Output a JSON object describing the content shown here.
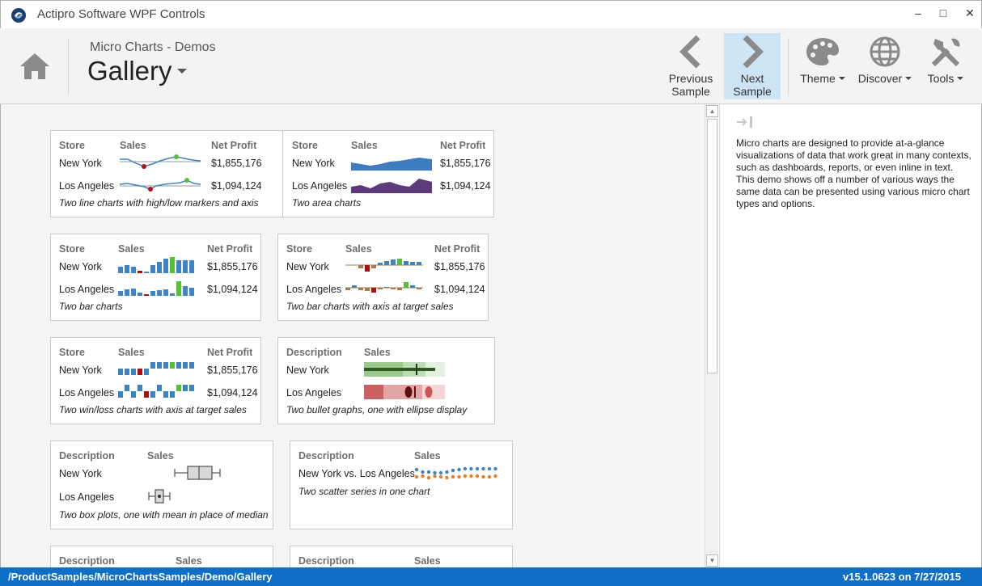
{
  "window": {
    "title": "Actipro Software WPF Controls",
    "minimize_glyph": "‒",
    "maximize_glyph": "□",
    "close_glyph": "✕"
  },
  "header": {
    "subtitle": "Micro Charts - Demos",
    "title": "Gallery",
    "buttons": {
      "previous": [
        "Previous",
        "Sample"
      ],
      "next": [
        "Next",
        "Sample"
      ],
      "theme": "Theme",
      "discover": "Discover",
      "tools": "Tools"
    }
  },
  "colors": {
    "accent": "#0f6fc6",
    "blue": "#3e84c5",
    "green": "#52c234",
    "red": "#b00d13",
    "tan": "#a57c4f",
    "orange": "#e67e22",
    "area_blue": "#3f7cbf",
    "area_purple": "#5d3b7a"
  },
  "cards": {
    "c1": {
      "h1": "Store",
      "h2": "Sales",
      "h3": "Net Profit",
      "r1": "New York",
      "r2": "Los Angeles",
      "v1": "$1,855,176",
      "v2": "$1,094,124",
      "caption": "Two line charts with high/low markers and axis"
    },
    "c2": {
      "h1": "Store",
      "h2": "Sales",
      "h3": "Net Profit",
      "r1": "New York",
      "r2": "Los Angeles",
      "v1": "$1,855,176",
      "v2": "$1,094,124",
      "caption": "Two area charts"
    },
    "c3": {
      "h1": "Store",
      "h2": "Sales",
      "h3": "Net Profit",
      "r1": "New York",
      "r2": "Los Angeles",
      "v1": "$1,855,176",
      "v2": "$1,094,124",
      "caption": "Two bar charts"
    },
    "c4": {
      "h1": "Store",
      "h2": "Sales",
      "h3": "Net Profit",
      "r1": "New York",
      "r2": "Los Angeles",
      "v1": "$1,855,176",
      "v2": "$1,094,124",
      "caption": "Two bar charts with axis at target sales"
    },
    "c5": {
      "h1": "Store",
      "h2": "Sales",
      "h3": "Net Profit",
      "r1": "New York",
      "r2": "Los Angeles",
      "v1": "$1,855,176",
      "v2": "$1,094,124",
      "caption": "Two win/loss charts with axis at target sales"
    },
    "c6": {
      "h1": "Description",
      "h2": "Sales",
      "r1": "New York",
      "r2": "Los Angeles",
      "caption": "Two bullet graphs, one with ellipse display"
    },
    "c7": {
      "h1": "Description",
      "h2": "Sales",
      "r1": "New York",
      "r2": "Los Angeles",
      "caption": "Two box plots, one with mean in place of median"
    },
    "c8": {
      "h1": "Description",
      "h2": "Sales",
      "r1": "New York vs. Los Angeles",
      "caption": "Two scatter series in one chart"
    },
    "c9": {
      "h1": "Description",
      "h2": "Sales"
    },
    "c10": {
      "h1": "Description",
      "h2": "Sales"
    }
  },
  "side_panel": {
    "description": "Micro charts are designed to provide at-a-glance visualizations of data that work great in many contexts, such as dashboards, reports, or even inline in text. This demo shows off a number of various ways the same data can be presented using various micro chart types and options."
  },
  "status": {
    "path": "/ProductSamples/MicroChartsSamples/Demo/Gallery",
    "version": "v15.1.0623 on 7/27/2015"
  }
}
